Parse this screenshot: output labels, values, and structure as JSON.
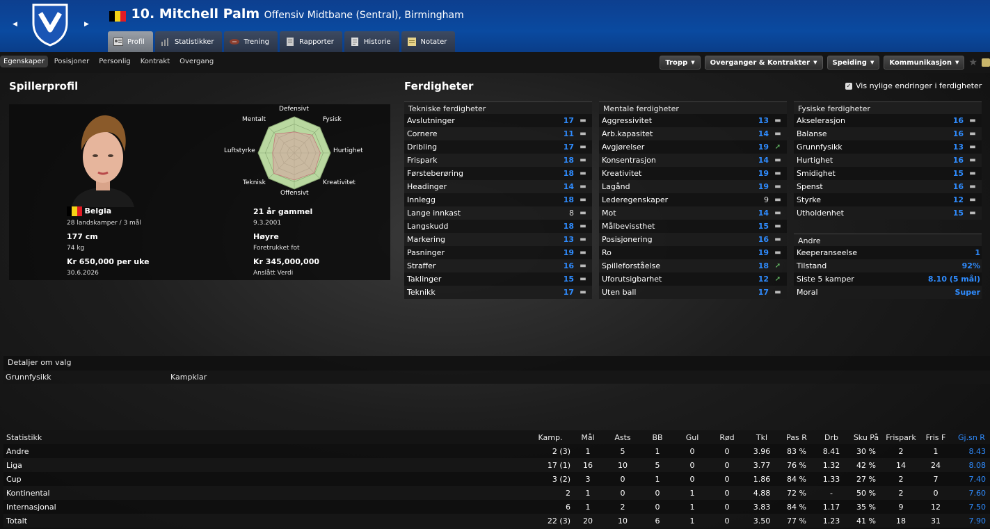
{
  "header": {
    "number_name": "10. Mitchell Palm",
    "role": "Offensiv Midtbane (Sentral), Birmingham",
    "flag_colors": [
      "#000000",
      "#f5d216",
      "#e21b24"
    ],
    "crest_colors": {
      "outline": "#ffffff",
      "fill": "#1a55b5"
    },
    "tabs": [
      {
        "label": "Profil",
        "icon": "profile-card-icon"
      },
      {
        "label": "Statistikker",
        "icon": "bar-chart-icon"
      },
      {
        "label": "Trening",
        "icon": "rugby-ball-icon"
      },
      {
        "label": "Rapporter",
        "icon": "report-icon"
      },
      {
        "label": "Historie",
        "icon": "history-icon"
      },
      {
        "label": "Notater",
        "icon": "notepad-icon"
      }
    ]
  },
  "subnav": {
    "tabs": [
      "Egenskaper",
      "Posisjoner",
      "Personlig",
      "Kontrakt",
      "Overgang"
    ],
    "menus": [
      "Tropp",
      "Overganger & Kontrakter",
      "Speiding",
      "Kommunikasjon"
    ]
  },
  "profile": {
    "title": "Spillerprofil",
    "nation": "Belgia",
    "caps": "28 landskamper / 3 mål",
    "height": "177 cm",
    "weight": "74 kg",
    "wage": "Kr 650,000 per uke",
    "contract_end": "30.6.2026",
    "age": "21 år gammel",
    "dob": "9.3.2001",
    "foot": "Høyre",
    "foot_label": "Foretrukket fot",
    "value": "Kr 345,000,000",
    "value_label": "Anslått Verdi",
    "radar": {
      "labels": [
        "Defensivt",
        "Fysisk",
        "Hurtighet",
        "Kreativitet",
        "Offensivt",
        "Teknisk",
        "Luftstyrke",
        "Mentalt"
      ],
      "values": [
        0.58,
        0.7,
        0.72,
        0.78,
        0.75,
        0.8,
        0.6,
        0.74
      ],
      "colors": {
        "fill": "#b9d8a0",
        "inner": "#d9a2a2",
        "line": "#8aa874"
      }
    }
  },
  "skills": {
    "title": "Ferdigheter",
    "show_recent_changes": "Vis nylige endringer i ferdigheter",
    "technical": {
      "heading": "Tekniske ferdigheter",
      "rows": [
        {
          "label": "Avslutninger",
          "value": "17",
          "trend": "flat",
          "highlight": true
        },
        {
          "label": "Cornere",
          "value": "11",
          "trend": "flat",
          "highlight": true
        },
        {
          "label": "Dribling",
          "value": "17",
          "trend": "flat",
          "highlight": true
        },
        {
          "label": "Frispark",
          "value": "18",
          "trend": "flat",
          "highlight": true
        },
        {
          "label": "Førsteberøring",
          "value": "18",
          "trend": "flat",
          "highlight": true
        },
        {
          "label": "Headinger",
          "value": "14",
          "trend": "flat",
          "highlight": true
        },
        {
          "label": "Innlegg",
          "value": "18",
          "trend": "flat",
          "highlight": true
        },
        {
          "label": "Lange innkast",
          "value": "8",
          "trend": "flat",
          "highlight": false
        },
        {
          "label": "Langskudd",
          "value": "18",
          "trend": "flat",
          "highlight": true
        },
        {
          "label": "Markering",
          "value": "13",
          "trend": "flat",
          "highlight": true
        },
        {
          "label": "Pasninger",
          "value": "19",
          "trend": "flat",
          "highlight": true
        },
        {
          "label": "Straffer",
          "value": "16",
          "trend": "flat",
          "highlight": true
        },
        {
          "label": "Taklinger",
          "value": "15",
          "trend": "flat",
          "highlight": true
        },
        {
          "label": "Teknikk",
          "value": "17",
          "trend": "flat",
          "highlight": true
        }
      ]
    },
    "mental": {
      "heading": "Mentale ferdigheter",
      "rows": [
        {
          "label": "Aggressivitet",
          "value": "13",
          "trend": "flat",
          "highlight": true
        },
        {
          "label": "Arb.kapasitet",
          "value": "14",
          "trend": "flat",
          "highlight": true
        },
        {
          "label": "Avgjørelser",
          "value": "19",
          "trend": "up",
          "highlight": true
        },
        {
          "label": "Konsentrasjon",
          "value": "14",
          "trend": "flat",
          "highlight": true
        },
        {
          "label": "Kreativitet",
          "value": "19",
          "trend": "flat",
          "highlight": true
        },
        {
          "label": "Lagånd",
          "value": "19",
          "trend": "flat",
          "highlight": true
        },
        {
          "label": "Lederegenskaper",
          "value": "9",
          "trend": "flat",
          "highlight": false
        },
        {
          "label": "Mot",
          "value": "14",
          "trend": "flat",
          "highlight": true
        },
        {
          "label": "Målbevissthet",
          "value": "15",
          "trend": "flat",
          "highlight": true
        },
        {
          "label": "Posisjonering",
          "value": "16",
          "trend": "flat",
          "highlight": true
        },
        {
          "label": "Ro",
          "value": "19",
          "trend": "flat",
          "highlight": true
        },
        {
          "label": "Spilleforståelse",
          "value": "18",
          "trend": "up",
          "highlight": true
        },
        {
          "label": "Uforutsigbarhet",
          "value": "12",
          "trend": "up",
          "highlight": true
        },
        {
          "label": "Uten ball",
          "value": "17",
          "trend": "flat",
          "highlight": true
        }
      ]
    },
    "physical": {
      "heading": "Fysiske ferdigheter",
      "rows": [
        {
          "label": "Akselerasjon",
          "value": "16",
          "trend": "flat",
          "highlight": true
        },
        {
          "label": "Balanse",
          "value": "16",
          "trend": "flat",
          "highlight": true
        },
        {
          "label": "Grunnfysikk",
          "value": "13",
          "trend": "flat",
          "highlight": true
        },
        {
          "label": "Hurtighet",
          "value": "16",
          "trend": "flat",
          "highlight": true
        },
        {
          "label": "Smidighet",
          "value": "15",
          "trend": "flat",
          "highlight": true
        },
        {
          "label": "Spenst",
          "value": "16",
          "trend": "flat",
          "highlight": true
        },
        {
          "label": "Styrke",
          "value": "12",
          "trend": "flat",
          "highlight": true
        },
        {
          "label": "Utholdenhet",
          "value": "15",
          "trend": "flat",
          "highlight": true
        }
      ]
    },
    "other": {
      "heading": "Andre",
      "rows": [
        {
          "label": "Keeperanseelse",
          "value": "1"
        },
        {
          "label": "Tilstand",
          "value": "92%"
        },
        {
          "label": "Siste 5 kamper",
          "value": "8.10 (5 mål)"
        },
        {
          "label": "Moral",
          "value": "Super"
        }
      ]
    }
  },
  "details": {
    "heading": "Detaljer om valg",
    "left": "Grunnfysikk",
    "right": "Kampklar"
  },
  "stats": {
    "columns": [
      "Statistikk",
      "Kamp.",
      "Mål",
      "Asts",
      "BB",
      "Gul",
      "Rød",
      "Tkl",
      "Pas R",
      "Drb",
      "Sku På",
      "Frispark",
      "Fris F",
      "Gj.sn R"
    ],
    "rows": [
      [
        "Andre",
        "2 (3)",
        "1",
        "5",
        "1",
        "0",
        "0",
        "3.96",
        "83 %",
        "8.41",
        "30 %",
        "2",
        "1",
        "8.43"
      ],
      [
        "Liga",
        "17 (1)",
        "16",
        "10",
        "5",
        "0",
        "0",
        "3.77",
        "76 %",
        "1.32",
        "42 %",
        "14",
        "24",
        "8.08"
      ],
      [
        "Cup",
        "3 (2)",
        "3",
        "0",
        "1",
        "0",
        "0",
        "1.86",
        "84 %",
        "1.33",
        "27 %",
        "2",
        "7",
        "7.40"
      ],
      [
        "Kontinental",
        "2",
        "1",
        "0",
        "0",
        "1",
        "0",
        "4.88",
        "72 %",
        "-",
        "50 %",
        "2",
        "0",
        "7.60"
      ],
      [
        "Internasjonal",
        "6",
        "1",
        "2",
        "0",
        "1",
        "0",
        "3.83",
        "84 %",
        "1.17",
        "35 %",
        "9",
        "12",
        "7.50"
      ],
      [
        "Totalt",
        "22 (3)",
        "20",
        "10",
        "6",
        "1",
        "0",
        "3.50",
        "77 %",
        "1.23",
        "41 %",
        "18",
        "31",
        "7.90"
      ]
    ]
  }
}
